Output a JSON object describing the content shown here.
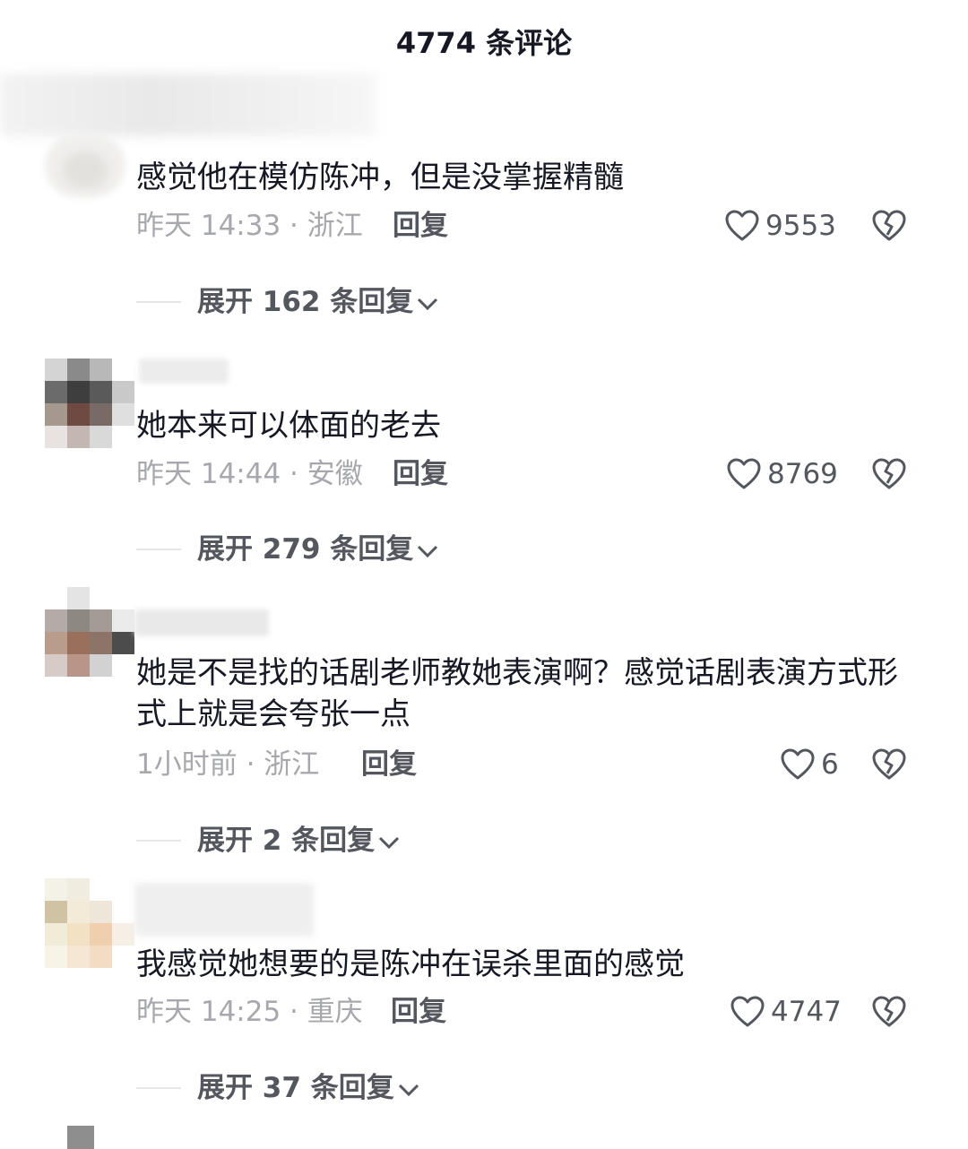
{
  "header": {
    "title": "4774 条评论"
  },
  "comments": [
    {
      "text": "感觉他在模仿陈冲，但是没掌握精髓",
      "meta": "昨天 14:33 · 浙江",
      "reply_label": "回复",
      "likes": "9553",
      "expand": "展开 162 条回复"
    },
    {
      "text": "她本来可以体面的老去",
      "meta": "昨天 14:44 · 安徽",
      "reply_label": "回复",
      "likes": "8769",
      "expand": "展开 279 条回复"
    },
    {
      "text": "她是不是找的话剧老师教她表演啊？感觉话剧表演方式形式上就是会夸张一点",
      "meta": "1小时前 · 浙江",
      "reply_label": "回复",
      "likes": "6",
      "expand": "展开 2 条回复"
    },
    {
      "text": "我感觉她想要的是陈冲在误杀里面的感觉",
      "meta": "昨天 14:25 · 重庆",
      "reply_label": "回复",
      "likes": "4747",
      "expand": "展开 37 条回复"
    }
  ],
  "icons": {
    "like": "heart-outline-icon",
    "dislike": "broken-heart-icon",
    "expand": "chevron-down-icon"
  },
  "colors": {
    "text": "#161823",
    "secondary": "#a7a8ad",
    "action": "#55575f"
  }
}
